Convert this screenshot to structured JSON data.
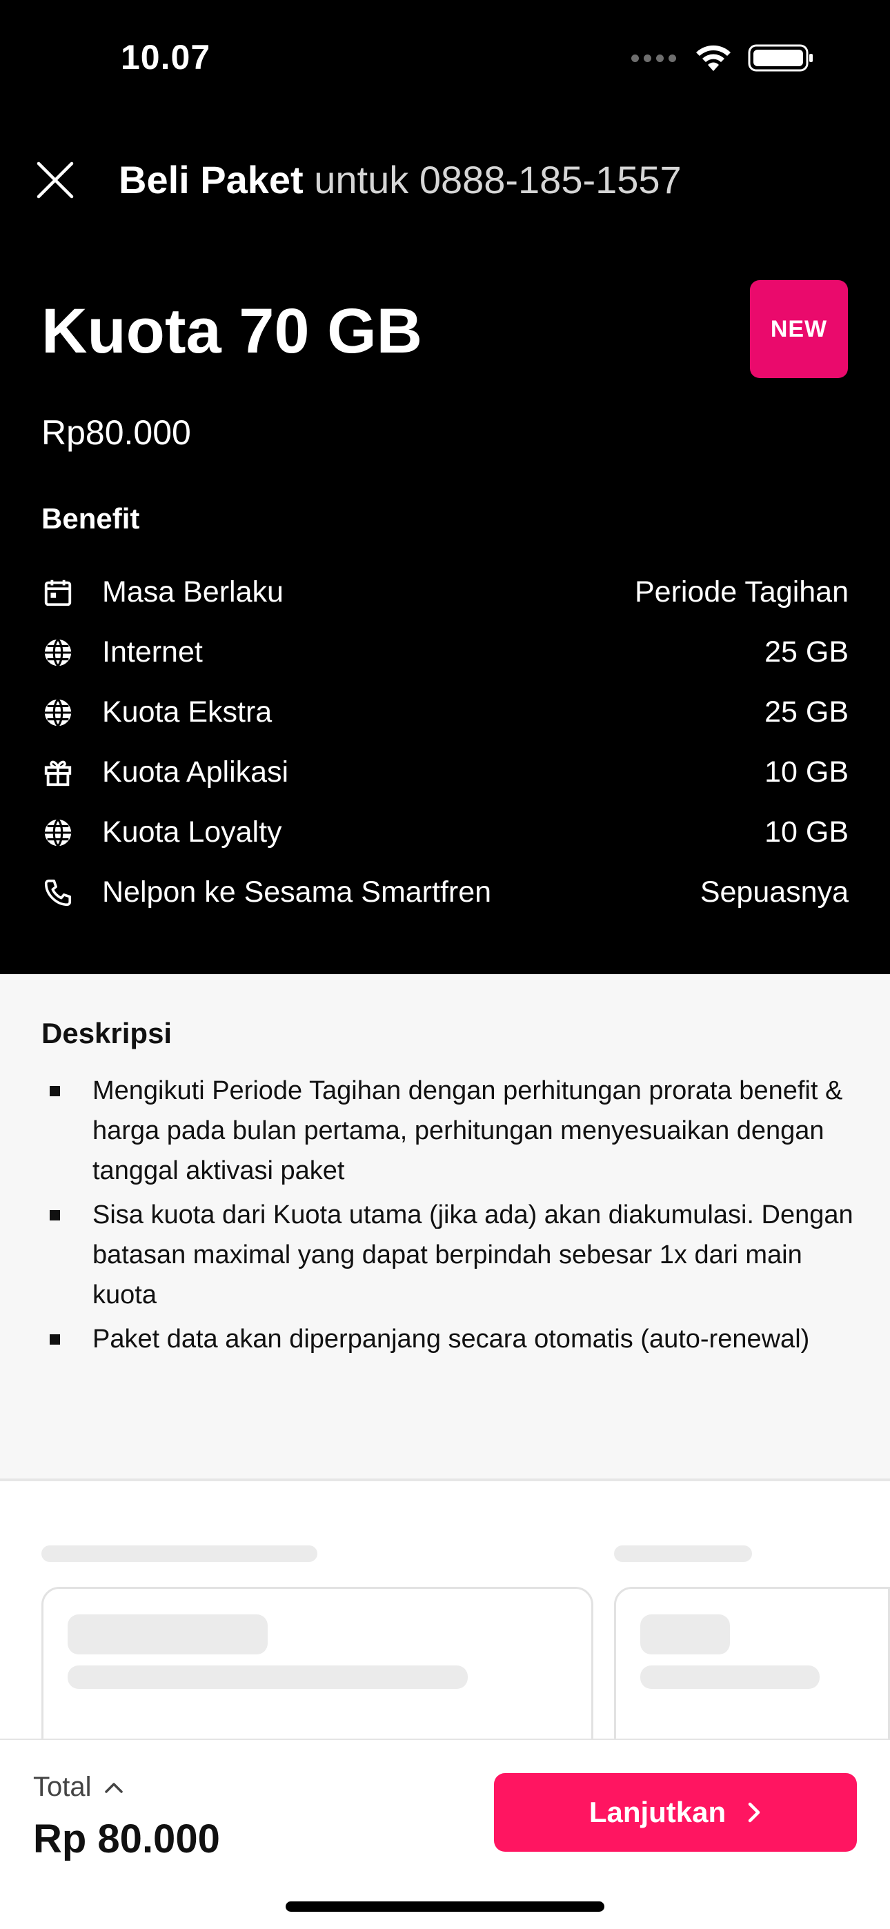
{
  "status_bar": {
    "time": "10.07"
  },
  "header": {
    "title_strong": "Beli Paket",
    "title_light": " untuk 0888-185-1557"
  },
  "package": {
    "name": "Kuota 70 GB",
    "badge": "NEW",
    "price": "Rp80.000"
  },
  "benefit": {
    "title": "Benefit",
    "items": [
      {
        "icon": "calendar-icon",
        "label": "Masa Berlaku",
        "value": "Periode Tagihan"
      },
      {
        "icon": "globe-icon",
        "label": "Internet",
        "value": "25 GB"
      },
      {
        "icon": "globe-icon",
        "label": "Kuota Ekstra",
        "value": "25 GB"
      },
      {
        "icon": "gift-icon",
        "label": "Kuota Aplikasi",
        "value": "10 GB"
      },
      {
        "icon": "globe-icon",
        "label": "Kuota Loyalty",
        "value": "10 GB"
      },
      {
        "icon": "phone-icon",
        "label": "Nelpon ke Sesama Smartfren",
        "value": "Sepuasnya"
      }
    ]
  },
  "description": {
    "title": "Deskripsi",
    "items": [
      "Mengikuti Periode Tagihan  dengan perhitungan prorata benefit & harga pada bulan pertama, perhitungan menyesuaikan dengan tanggal aktivasi paket",
      "Sisa kuota dari Kuota utama (jika ada) akan diakumulasi. Dengan batasan maximal yang dapat berpindah sebesar 1x dari main kuota",
      "Paket data akan diperpanjang secara otomatis (auto-renewal)"
    ]
  },
  "footer": {
    "total_label": "Total",
    "total_amount": "Rp 80.000",
    "cta_label": "Lanjutkan"
  },
  "colors": {
    "badge": "#ea0a6c",
    "cta": "#ff1561",
    "header_bg": "#000000",
    "description_bg": "#f7f7f7"
  }
}
